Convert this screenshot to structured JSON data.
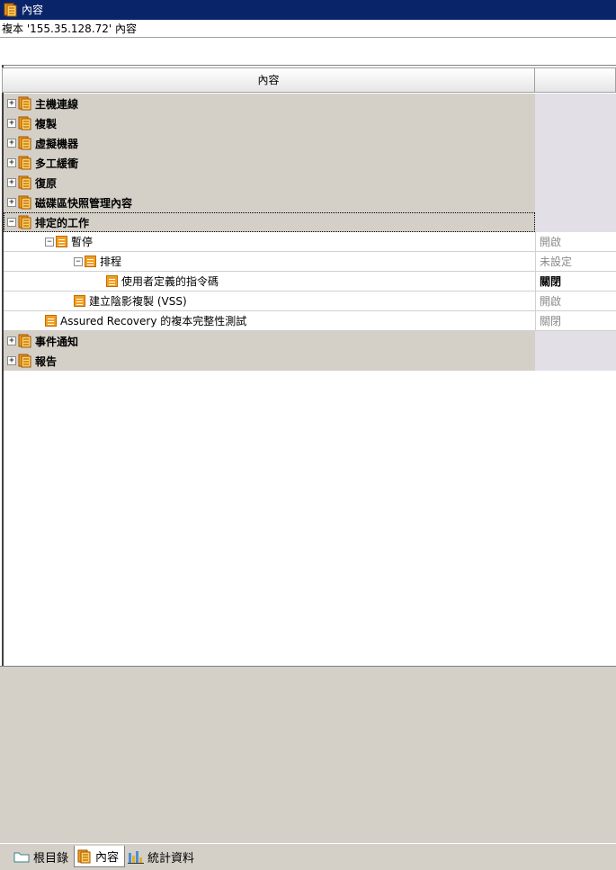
{
  "window": {
    "title": "內容",
    "subtitle": "複本 '155.35.128.72' 內容"
  },
  "grid": {
    "header": {
      "col_name": "內容",
      "col_value": ""
    },
    "rows": [
      {
        "label": "主機連線",
        "value": "",
        "expander": "⊞",
        "level": 0,
        "style": "g"
      },
      {
        "label": "複製",
        "value": "",
        "expander": "⊞",
        "level": 0,
        "style": "g"
      },
      {
        "label": "虛擬機器",
        "value": "",
        "expander": "⊞",
        "level": 0,
        "style": "g"
      },
      {
        "label": "多工緩衝",
        "value": "",
        "expander": "⊞",
        "level": 0,
        "style": "g"
      },
      {
        "label": "復原",
        "value": "",
        "expander": "⊞",
        "level": 0,
        "style": "g"
      },
      {
        "label": "磁碟區快照管理內容",
        "value": "",
        "expander": "⊞",
        "level": 0,
        "style": "g"
      },
      {
        "label": "排定的工作",
        "value": "",
        "expander": "⊟",
        "level": 0,
        "style": "g"
      },
      {
        "label": "暫停",
        "value": "開啟",
        "expander": "⊟",
        "level": 1,
        "style": "w"
      },
      {
        "label": "排程",
        "value": "未設定",
        "expander": "⊟",
        "level": 2,
        "style": "w"
      },
      {
        "label": "使用者定義的指令碼",
        "value": "關閉",
        "expander": "",
        "level": 3,
        "style": "w"
      },
      {
        "label": "建立陰影複製 (VSS)",
        "value": "開啟",
        "expander": "",
        "level": 2,
        "style": "w"
      },
      {
        "label": "Assured Recovery 的複本完整性測試",
        "value": "關閉",
        "expander": "",
        "level": 1,
        "style": "w"
      },
      {
        "label": "事件通知",
        "value": "",
        "expander": "⊞",
        "level": 0,
        "style": "g"
      },
      {
        "label": "報告",
        "value": "",
        "expander": "⊞",
        "level": 0,
        "style": "g"
      }
    ]
  },
  "tabs": [
    {
      "label": "根目錄",
      "icon": "folder-icon"
    },
    {
      "label": "內容",
      "icon": "properties-icon"
    },
    {
      "label": "統計資料",
      "icon": "statistics-icon"
    }
  ]
}
